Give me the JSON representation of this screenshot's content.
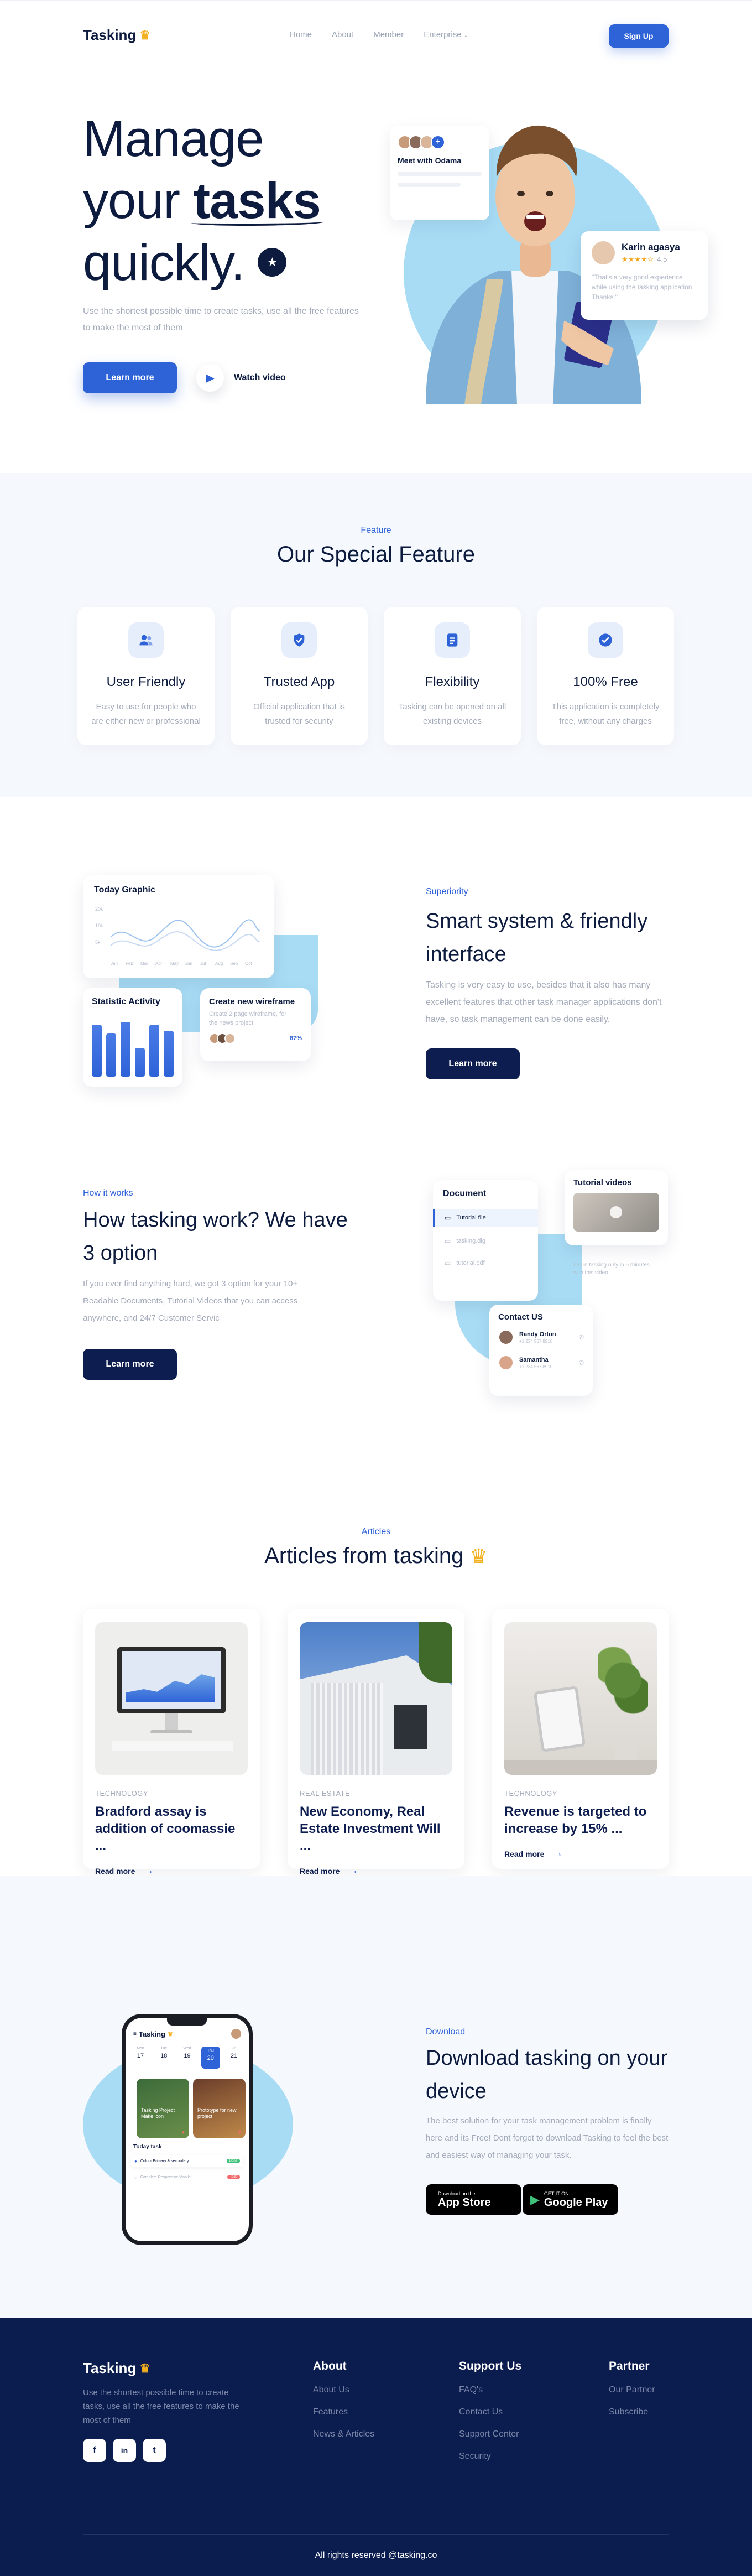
{
  "brand": {
    "name": "Tasking",
    "accent": "#2e63d8",
    "navy": "#0d1b3e",
    "light_blue": "#a8dcf5"
  },
  "nav": {
    "links": [
      "Home",
      "About",
      "Member",
      "Enterprise"
    ],
    "signup_label": "Sign Up"
  },
  "hero": {
    "title_line1": "Manage",
    "title_line2_a": "your ",
    "title_line2_b": "tasks",
    "title_line3": "quickly.",
    "subtitle": "Use the shortest possible time to create tasks, use all the free features to make the most of them",
    "learn_more": "Learn more",
    "watch_video": "Watch video",
    "meet_title": "Meet with Odama",
    "review": {
      "name": "Karin agasya",
      "rating": "4.5",
      "text": "\"That's a very good experience while using the tasking application. Thanks \""
    }
  },
  "feature": {
    "eyebrow": "Feature",
    "title": "Our Special Feature",
    "cards": [
      {
        "icon": "users-icon",
        "name": "User Friendly",
        "desc": "Easy to use for people who are either new or professional"
      },
      {
        "icon": "shield-icon",
        "name": "Trusted App",
        "desc": "Official application that is trusted for security"
      },
      {
        "icon": "document-icon",
        "name": "Flexibility",
        "desc": "Tasking can be opened on all existing devices"
      },
      {
        "icon": "badge-icon",
        "name": "100% Free",
        "desc": "This application is completely free, without any charges"
      }
    ]
  },
  "superiority": {
    "today_graphic": "Today Graphic",
    "graph_y": [
      "20k",
      "10k",
      "5k"
    ],
    "graph_x": [
      "Jan",
      "Feb",
      "Mar",
      "Apr",
      "May",
      "Jun",
      "Jul",
      "Aug",
      "Sep",
      "Oct"
    ],
    "statistic_title": "Statistic Activity",
    "stat_bars": [
      0.9,
      0.75,
      0.95,
      0.5,
      0.9,
      0.8
    ],
    "wireframe_title": "Create new wireframe",
    "wireframe_desc": "Create 2 page wireframe, for the news project",
    "wireframe_pct": "87%",
    "eyebrow": "Superiority",
    "title": "Smart system & friendly interface",
    "desc": "Tasking is very easy to use, besides that it also has many excellent features that other task manager applications don't have, so task management can be done easily.",
    "learn_more": "Learn more"
  },
  "how": {
    "eyebrow": "How it works",
    "title": "How tasking work? We have 3 option",
    "desc": "If you ever find anything hard, we got 3 option for your 10+ Readable Documents, Tutorial Videos that you can access anywhere, and 24/7 Customer Servic",
    "learn_more": "Learn more",
    "document_title": "Document",
    "documents": [
      "Tutorial file",
      "tasking.dig",
      "tutorial.pdf"
    ],
    "tutorial_title": "Tutorial videos",
    "tutorial_desc": "Learn tasking only in 5 minutes with this video",
    "contact_title": "Contact US",
    "contacts": [
      {
        "name": "Randy Orton",
        "phone": "+1 234 567 8910"
      },
      {
        "name": "Samantha",
        "phone": "+1 234 567 8910"
      }
    ]
  },
  "articles": {
    "eyebrow": "Articles",
    "title": "Articles from tasking",
    "read_more": "Read more",
    "items": [
      {
        "category": "TECHNOLOGY",
        "headline": "Bradford assay is addition of coomassie ..."
      },
      {
        "category": "REAL ESTATE",
        "headline": "New Economy, Real Estate Investment Will ..."
      },
      {
        "category": "TECHNOLOGY",
        "headline": "Revenue is targeted to increase by 15% ..."
      }
    ]
  },
  "download": {
    "eyebrow": "Download",
    "title": "Download tasking on your device",
    "desc": "The best solution for your task management problem is finally here and its Free! Dont forget to download Tasking to feel the best and easiest way of managing your task.",
    "appstore_small": "Download on the",
    "appstore_big": "App Store",
    "play_small": "GET IT ON",
    "play_big": "Google Play",
    "phone": {
      "app_name": "Tasking",
      "days": [
        "Mon",
        "Tue",
        "Wed",
        "Thu",
        "Fri"
      ],
      "dates": [
        "17",
        "18",
        "19",
        "20",
        "21"
      ],
      "project1": "Tasking Project Make icon",
      "project2": "Prototype for new project",
      "today_task": "Today task",
      "task1": "Colour Primary & secondary",
      "task1_tag": "Done",
      "task2": "Complete Responsive Mobile",
      "task2_tag": "Todo"
    }
  },
  "footer": {
    "logo": "Tasking",
    "tagline": "Use the shortest possible time to create tasks, use all the free features to make the most of them",
    "social": [
      "f",
      "in",
      "t"
    ],
    "columns": [
      {
        "title": "About",
        "items": [
          "About Us",
          "Features",
          "News & Articles"
        ]
      },
      {
        "title": "Support Us",
        "items": [
          "FAQ's",
          "Contact Us",
          "Support Center",
          "Security"
        ]
      },
      {
        "title": "Partner",
        "items": [
          "Our Partner",
          "Subscribe"
        ]
      }
    ],
    "copyright": "All rights reserved @tasking.co"
  }
}
